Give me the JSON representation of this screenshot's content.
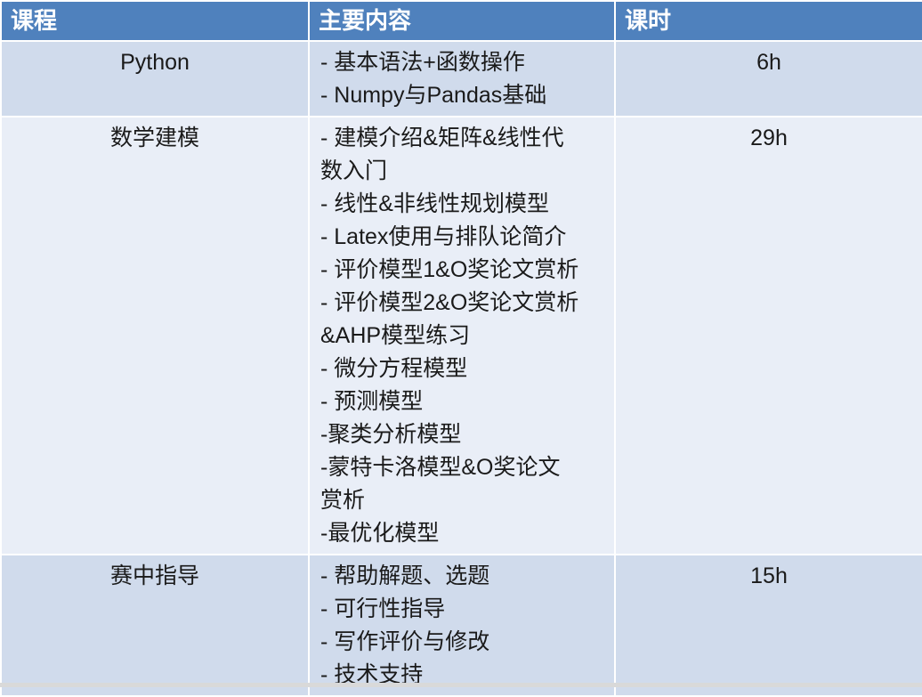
{
  "header": {
    "col_course": "课程",
    "col_content": "主要内容",
    "col_hours": "课时"
  },
  "rows": [
    {
      "course": "Python",
      "content": [
        "- 基本语法+函数操作",
        "- Numpy与Pandas基础"
      ],
      "hours": "6h"
    },
    {
      "course": "数学建模",
      "content": [
        "- 建模介绍&矩阵&线性代",
        "数入门",
        "- 线性&非线性规划模型",
        "- Latex使用与排队论简介",
        "- 评价模型1&O奖论文赏析",
        "- 评价模型2&O奖论文赏析",
        "&AHP模型练习",
        "- 微分方程模型",
        "- 预测模型",
        "-聚类分析模型",
        "-蒙特卡洛模型&O奖论文",
        "赏析",
        "-最优化模型"
      ],
      "hours": "29h"
    },
    {
      "course": "赛中指导",
      "content": [
        "- 帮助解题、选题",
        "- 可行性指导",
        "- 写作评价与修改",
        "- 技术支持"
      ],
      "hours": "15h"
    }
  ]
}
